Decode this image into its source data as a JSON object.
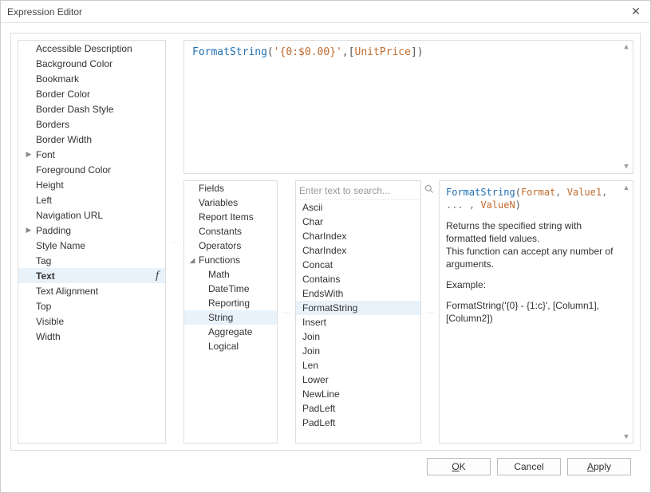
{
  "title": "Expression Editor",
  "properties": [
    {
      "label": "Accessible Description",
      "expandable": false
    },
    {
      "label": "Background Color",
      "expandable": false
    },
    {
      "label": "Bookmark",
      "expandable": false
    },
    {
      "label": "Border Color",
      "expandable": false
    },
    {
      "label": "Border Dash Style",
      "expandable": false
    },
    {
      "label": "Borders",
      "expandable": false
    },
    {
      "label": "Border Width",
      "expandable": false
    },
    {
      "label": "Font",
      "expandable": true
    },
    {
      "label": "Foreground Color",
      "expandable": false
    },
    {
      "label": "Height",
      "expandable": false
    },
    {
      "label": "Left",
      "expandable": false
    },
    {
      "label": "Navigation URL",
      "expandable": false
    },
    {
      "label": "Padding",
      "expandable": true
    },
    {
      "label": "Style Name",
      "expandable": false
    },
    {
      "label": "Tag",
      "expandable": false
    },
    {
      "label": "Text",
      "expandable": false,
      "selected": true,
      "fx": true
    },
    {
      "label": "Text Alignment",
      "expandable": false
    },
    {
      "label": "Top",
      "expandable": false
    },
    {
      "label": "Visible",
      "expandable": false
    },
    {
      "label": "Width",
      "expandable": false
    }
  ],
  "expression": {
    "fn": "FormatString",
    "open": "(",
    "str": "'{0:$0.00}'",
    "comma": ",",
    "lbr": "[",
    "field": "UnitPrice",
    "rbr": "]",
    "close": ")"
  },
  "categories": [
    {
      "label": "Fields",
      "level": 0
    },
    {
      "label": "Variables",
      "level": 0
    },
    {
      "label": "Report Items",
      "level": 0
    },
    {
      "label": "Constants",
      "level": 0
    },
    {
      "label": "Operators",
      "level": 0
    },
    {
      "label": "Functions",
      "level": 0,
      "expandable": true,
      "expanded": true
    },
    {
      "label": "Math",
      "level": 1
    },
    {
      "label": "DateTime",
      "level": 1
    },
    {
      "label": "Reporting",
      "level": 1
    },
    {
      "label": "String",
      "level": 1,
      "selected": true
    },
    {
      "label": "Aggregate",
      "level": 1
    },
    {
      "label": "Logical",
      "level": 1
    }
  ],
  "search": {
    "placeholder": "Enter text to search..."
  },
  "functions": [
    "Ascii",
    "Char",
    "CharIndex",
    "CharIndex",
    "Concat",
    "Contains",
    "EndsWith",
    "FormatString",
    "Insert",
    "Join",
    "Join",
    "Len",
    "Lower",
    "NewLine",
    "PadLeft",
    "PadLeft"
  ],
  "selectedFunction": "FormatString",
  "help": {
    "sig_fn": "FormatString",
    "sig_open": "(",
    "sig_arg1": "Format",
    "sig_c1": ", ",
    "sig_arg2": "Value1",
    "sig_c2": ", ... , ",
    "sig_arg3": "ValueN",
    "sig_close": ")",
    "desc1": "Returns the specified string with formatted field values.",
    "desc2": "This function can accept any number of arguments.",
    "example_label": "Example:",
    "example": "FormatString('{0} - {1:c}', [Column1], [Column2])"
  },
  "buttons": {
    "ok_pre": "",
    "ok_ul": "O",
    "ok_post": "K",
    "cancel": "Cancel",
    "apply_pre": "",
    "apply_ul": "A",
    "apply_post": "pply"
  }
}
